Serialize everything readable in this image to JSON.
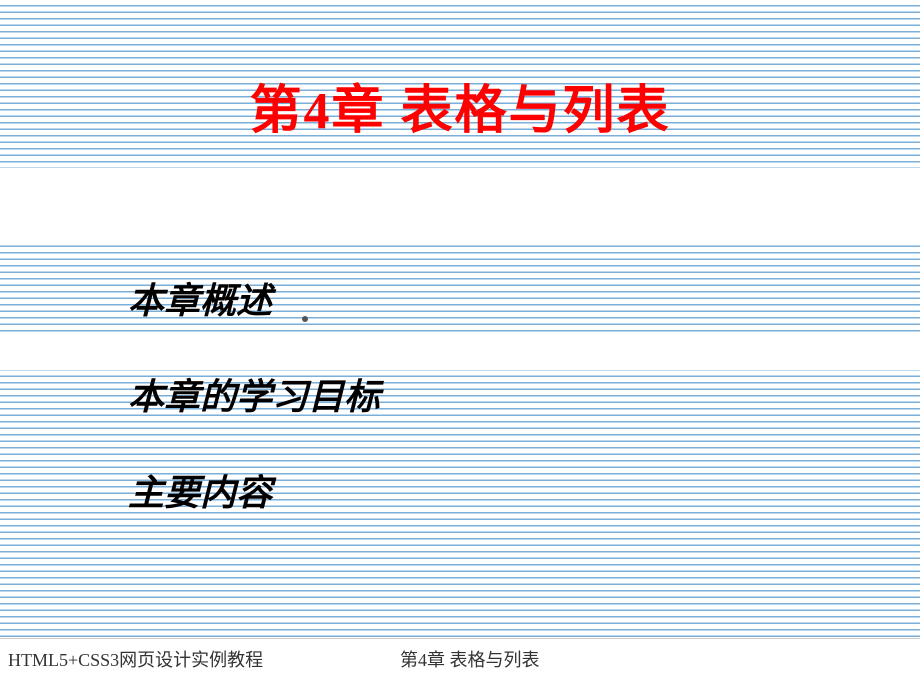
{
  "title": "第4章  表格与列表",
  "sections": {
    "item1": "本章概述",
    "item2": "本章的学习目标",
    "item3": "主要内容"
  },
  "footer": {
    "left": "HTML5+CSS3网页设计实例教程",
    "center": "第4章  表格与列表"
  }
}
